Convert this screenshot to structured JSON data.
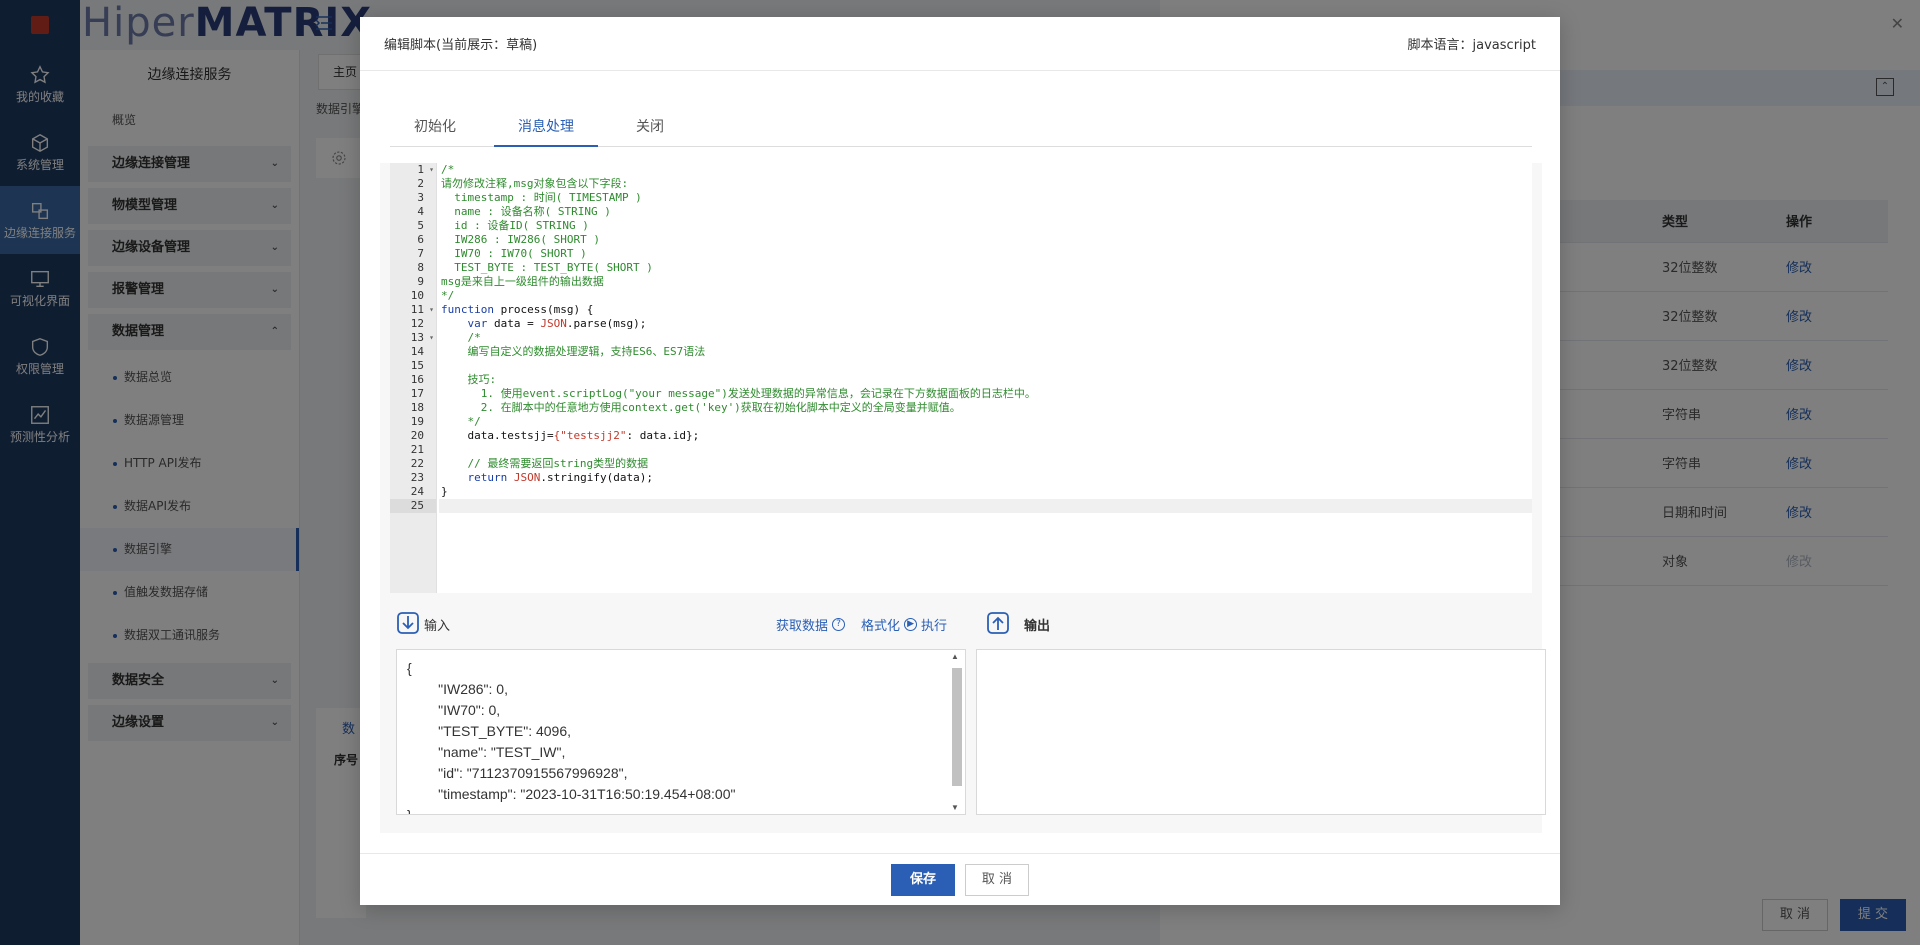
{
  "brand": {
    "prefix": "Hiper",
    "name": "MATRIX"
  },
  "rail": {
    "items": [
      {
        "icon": "star-icon",
        "label": "我的收藏"
      },
      {
        "icon": "cube-icon",
        "label": "系统管理"
      },
      {
        "icon": "edge-connect-icon",
        "label": "边缘连接服务"
      },
      {
        "icon": "monitor-icon",
        "label": "可视化界面"
      },
      {
        "icon": "shield-icon",
        "label": "权限管理"
      },
      {
        "icon": "chart-icon",
        "label": "预测性分析"
      }
    ]
  },
  "menu": {
    "header": "边缘连接服务",
    "overview": "概览",
    "groups": [
      "边缘连接管理",
      "物模型管理",
      "边缘设备管理",
      "报警管理",
      "数据管理"
    ],
    "leaves": [
      "数据总览",
      "数据源管理",
      "HTTP API发布",
      "数据API发布",
      "数据引擎",
      "值触发数据存储",
      "数据双工通讯服务"
    ],
    "bottom_groups": [
      "数据安全",
      "边缘设置"
    ]
  },
  "main": {
    "home_tab": "主页",
    "breadcrumb": "数据引擎",
    "data_card_title": "数",
    "data_card_col": "序号"
  },
  "drawer": {
    "columns": [
      "类型",
      "操作"
    ],
    "rows": [
      {
        "type": "32位整数",
        "op": "修改"
      },
      {
        "type": "32位整数",
        "op": "修改"
      },
      {
        "type": "32位整数",
        "op": "修改"
      },
      {
        "type": "字符串",
        "op": "修改"
      },
      {
        "type": "字符串",
        "op": "修改"
      },
      {
        "type": "日期和时间",
        "op": "修改"
      },
      {
        "type": "对象",
        "op": "修改"
      }
    ],
    "cancel": "取 消",
    "submit": "提 交"
  },
  "modal": {
    "title": "编辑脚本(当前展示：草稿)",
    "lang_label": "脚本语言：javascript",
    "tabs": [
      "初始化",
      "消息处理",
      "关闭"
    ],
    "active_tab": "消息处理",
    "code_lines": [
      "/*",
      "请勿修改注释,msg对象包含以下字段:",
      "  timestamp : 时间( TIMESTAMP )",
      "  name : 设备名称( STRING )",
      "  id : 设备ID( STRING )",
      "  IW286 : IW286( SHORT )",
      "  IW70 : IW70( SHORT )",
      "  TEST_BYTE : TEST_BYTE( SHORT )",
      "msg是来自上一级组件的输出数据",
      "*/",
      "function process(msg) {",
      "    var data = JSON.parse(msg);",
      "    /*",
      "    编写自定义的数据处理逻辑，支持ES6、ES7语法",
      "",
      "    技巧:",
      "      1. 使用event.scriptLog(\"your message\")发送处理数据的异常信息，会记录在下方数据面板的日志栏中。",
      "      2. 在脚本中的任意地方使用context.get('key')获取在初始化脚本中定义的全局变量并赋值。",
      "    */",
      "    data.testsjj={\"testsjj2\": data.id};",
      "",
      "    // 最终需要返回string类型的数据",
      "    return JSON.stringify(data);",
      "}",
      ""
    ],
    "input_label": "输入",
    "output_label": "输出",
    "get_data": "获取数据",
    "format": "格式化",
    "execute": "执行",
    "input_json_lines": [
      "{",
      "        \"IW286\": 0,",
      "        \"IW70\": 0,",
      "        \"TEST_BYTE\": 4096,",
      "        \"name\": \"TEST_IW\",",
      "        \"id\": \"7112370915567996928\",",
      "        \"timestamp\": \"2023-10-31T16:50:19.454+08:00\"",
      "}"
    ],
    "save": "保存",
    "cancel": "取 消"
  },
  "colors": {
    "primary": "#2a5fb5",
    "rail": "#1f3a63",
    "comment": "#2e8b2e",
    "keyword": "#1a3ea8"
  }
}
